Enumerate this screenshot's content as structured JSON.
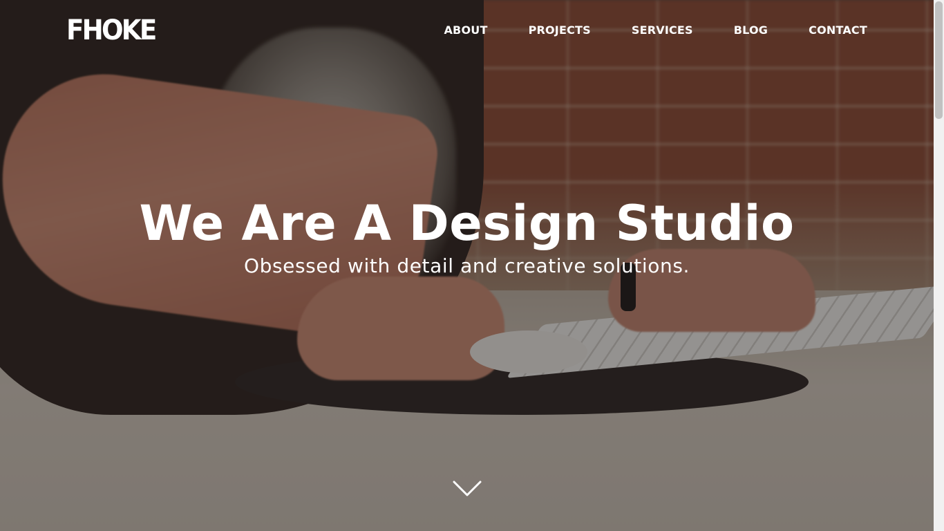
{
  "header": {
    "logo_text": "FHOKE",
    "nav_items": [
      {
        "label": "ABOUT"
      },
      {
        "label": "PROJECTS"
      },
      {
        "label": "SERVICES"
      },
      {
        "label": "BLOG"
      },
      {
        "label": "CONTACT"
      }
    ]
  },
  "hero": {
    "title": "We Are A Design Studio",
    "subtitle": "Obsessed with detail and creative solutions.",
    "scroll_icon": "chevron-down-icon"
  },
  "colors": {
    "text": "#ffffff",
    "overlay": "#19120f",
    "scrollbar_track": "#f1f1f1",
    "scrollbar_thumb": "#c1c1c1"
  }
}
